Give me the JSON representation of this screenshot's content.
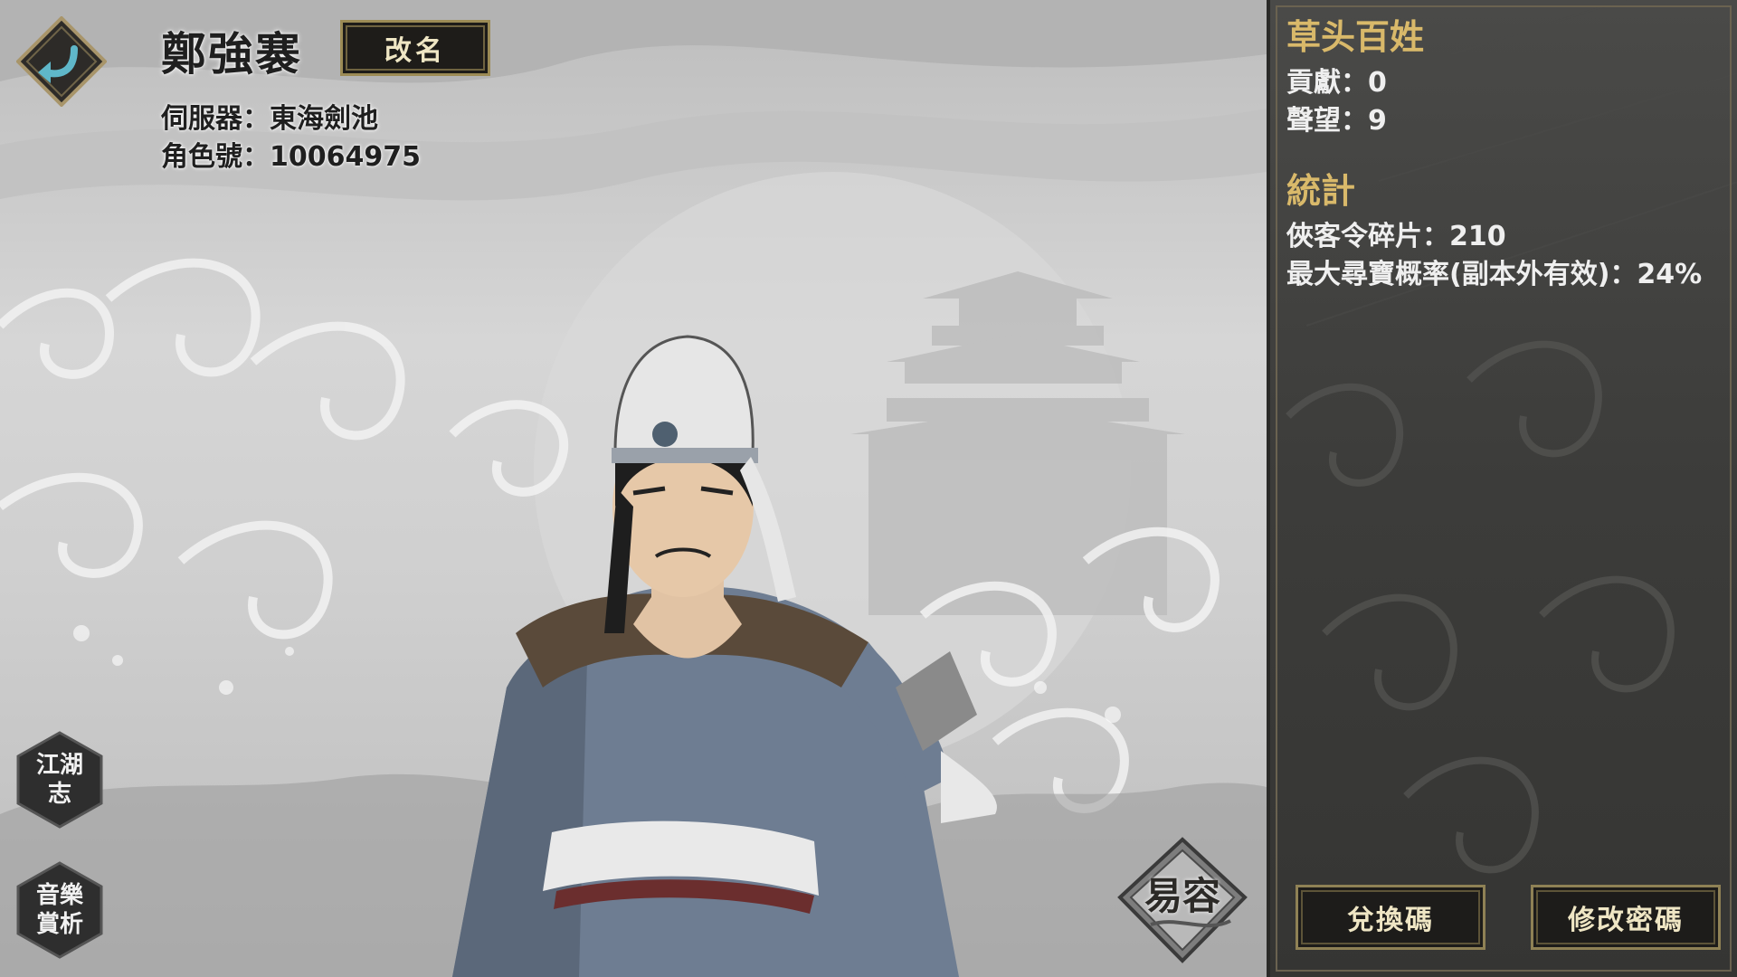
{
  "player": {
    "name": "鄭強褰",
    "rename_label": "改名",
    "server_line": "伺服器：東海劍池",
    "role_line": "角色號：10064975"
  },
  "side_buttons": {
    "journal_line1": "江湖",
    "journal_line2": "志",
    "music_line1": "音樂",
    "music_line2": "賞析"
  },
  "disguise_label": "易容",
  "panel": {
    "rank_title": "草头百姓",
    "contribution": "貢獻：0",
    "reputation": "聲望：9",
    "stats_title": "統計",
    "fragments": "俠客令碎片：210",
    "treasure_rate": "最大尋寶概率(副本外有效)：24%",
    "redeem_label": "兌換碼",
    "change_password_label": "修改密碼"
  },
  "colors": {
    "gold_title": "#d9b96a",
    "panel_bg": "#3c3c3a",
    "button_bg": "#1d1c1a"
  },
  "icons": {
    "back": "back-arrow-icon",
    "journal": "hexagon-journal-icon",
    "music": "hexagon-music-icon",
    "disguise": "diamond-disguise-icon"
  }
}
